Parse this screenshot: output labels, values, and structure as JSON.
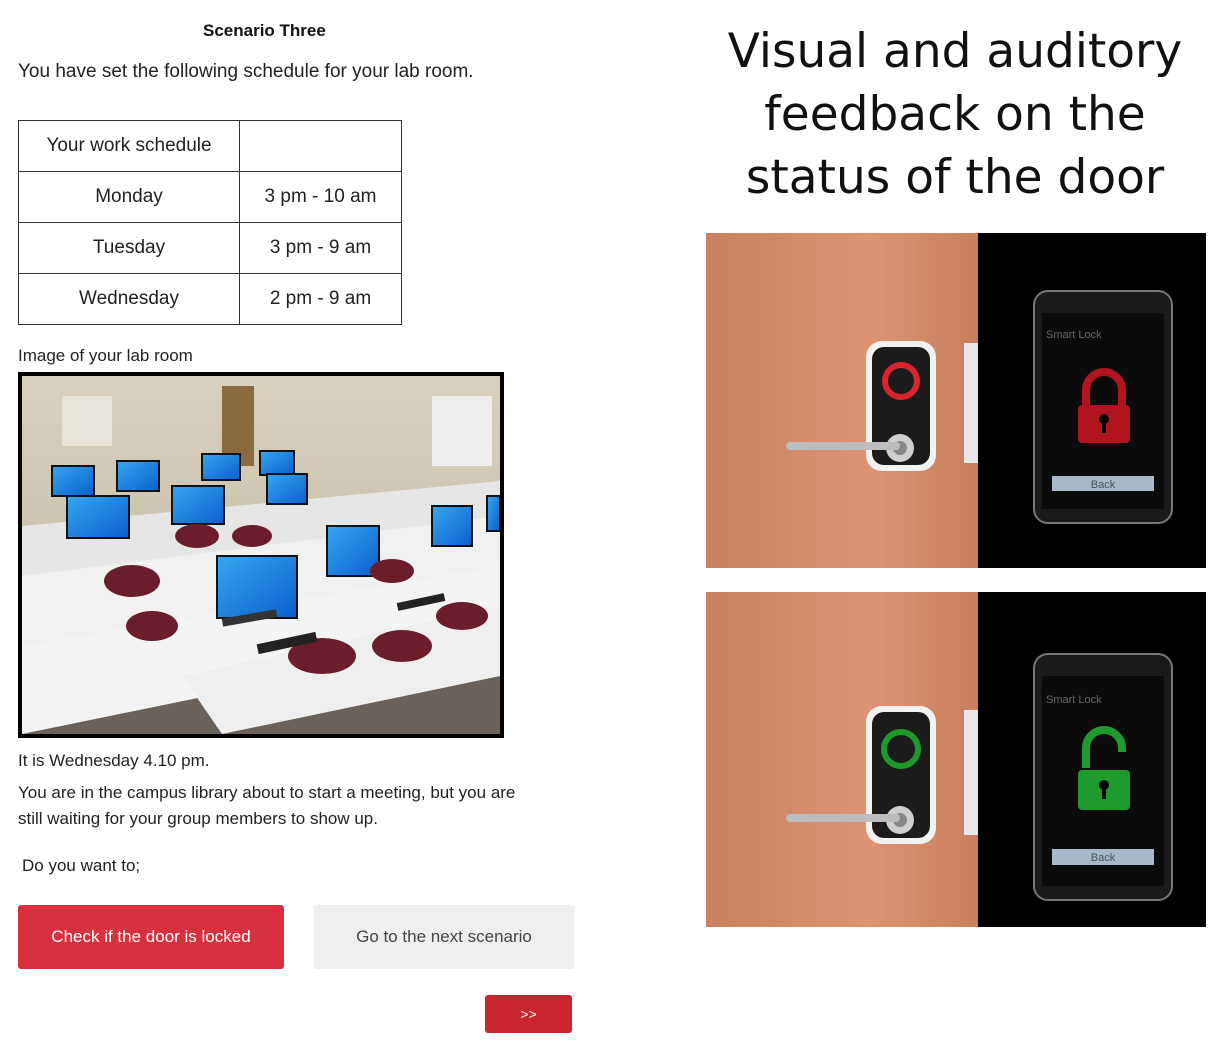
{
  "scenario": {
    "title": "Scenario Three",
    "intro": "You have set the following schedule for your lab room.",
    "schedule": {
      "header": "Your work schedule",
      "header_value": "",
      "rows": [
        {
          "day": "Monday",
          "time": "3 pm - 10 am"
        },
        {
          "day": "Tuesday",
          "time": "3 pm - 9 am"
        },
        {
          "day": "Wednesday",
          "time": "2 pm - 9 am"
        }
      ]
    },
    "image_caption": "Image of your lab room",
    "day_line": "It is Wednesday 4.10 pm.",
    "situation": "You are in the campus library about to start a meeting, but you are still waiting for your group members to show up.",
    "question": "Do you want to;",
    "buttons": {
      "check_door": "Check if the door is locked",
      "next_scenario": "Go to the next scenario",
      "next": ">>"
    }
  },
  "feedback": {
    "heading_lines": [
      "Visual and auditory",
      "feedback on the",
      "status of the door"
    ],
    "phone_app_title": "Smart Lock",
    "phone_back_label": "Back",
    "locked_color": "#b0141e",
    "unlocked_color": "#1f9a2c"
  },
  "colors": {
    "primary_button": "#d9303f",
    "secondary_button": "#efefef",
    "next_button": "#c9262f"
  }
}
